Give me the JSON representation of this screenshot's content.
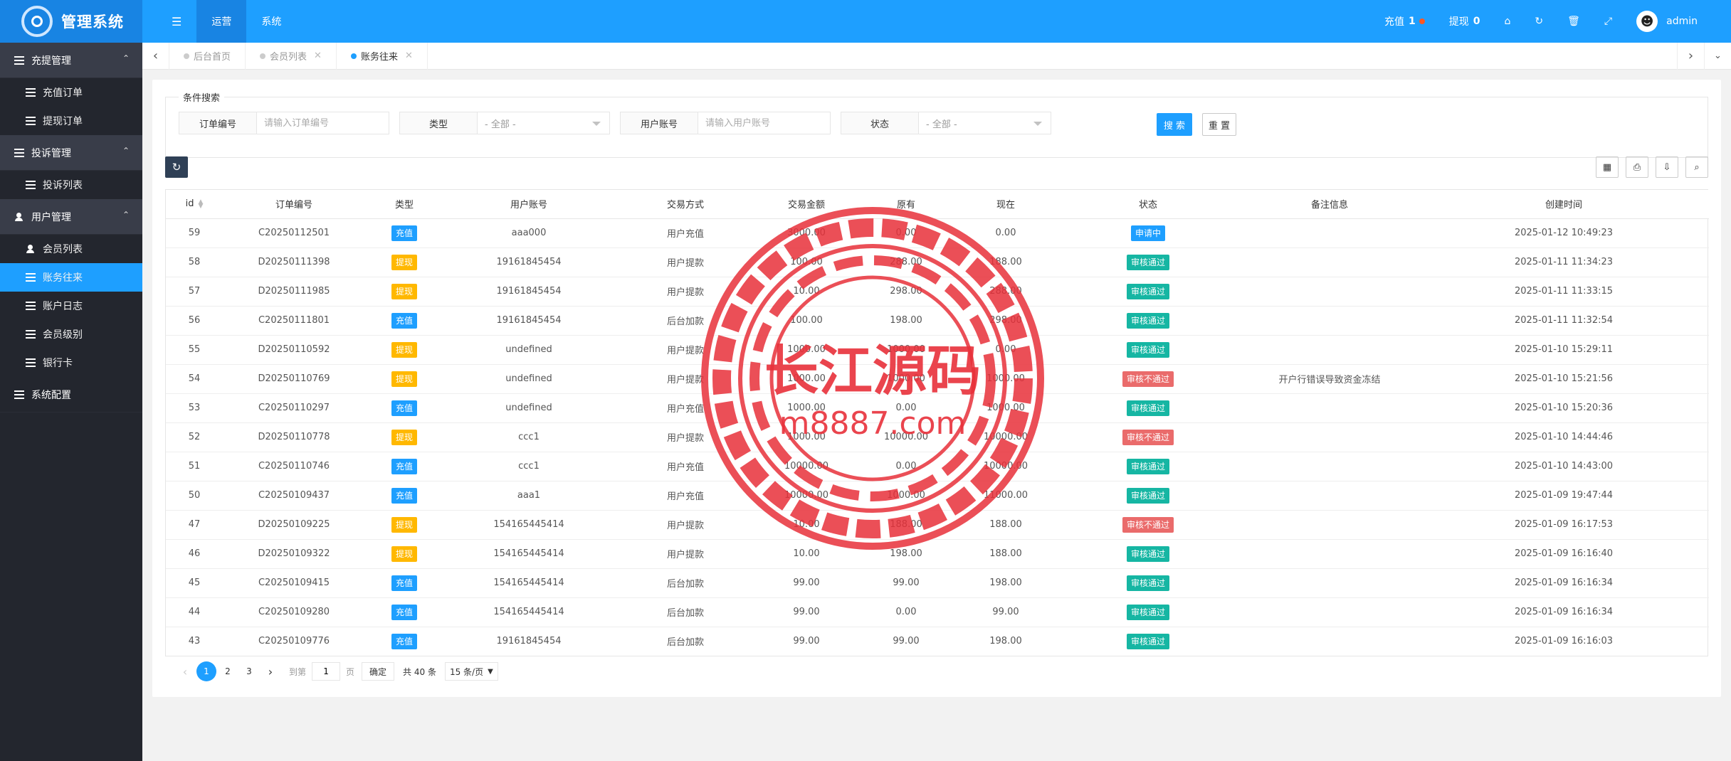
{
  "app": {
    "title": "管理系统"
  },
  "top_menu": [
    "运营",
    "系统"
  ],
  "top_right": {
    "recharge_label": "充值",
    "recharge_count": "1",
    "withdraw_label": "提现",
    "withdraw_count": "0",
    "user": "admin"
  },
  "sidebar": {
    "groups": [
      {
        "label": "充提管理",
        "items": [
          "充值订单",
          "提现订单"
        ]
      },
      {
        "label": "投诉管理",
        "items": [
          "投诉列表"
        ]
      },
      {
        "label": "用户管理",
        "items": [
          "会员列表",
          "账务往来",
          "账户日志",
          "会员级别",
          "银行卡"
        ]
      },
      {
        "label": "系统配置",
        "items": []
      }
    ],
    "active_item": "账务往来"
  },
  "tabs": [
    "后台首页",
    "会员列表",
    "账务往来"
  ],
  "search": {
    "legend": "条件搜索",
    "order_label": "订单编号",
    "order_placeholder": "请输入订单编号",
    "type_label": "类型",
    "type_value": "- 全部 -",
    "account_label": "用户账号",
    "account_placeholder": "请输入用户账号",
    "status_label": "状态",
    "status_value": "- 全部 -",
    "search_btn": "搜 索",
    "reset_btn": "重 置"
  },
  "table": {
    "columns": [
      "id",
      "订单编号",
      "类型",
      "用户账号",
      "交易方式",
      "交易金额",
      "原有",
      "现在",
      "状态",
      "备注信息",
      "创建时间"
    ],
    "rows": [
      [
        "59",
        "C20250112501",
        "充值",
        "aaa000",
        "用户充值",
        "3000.00",
        "0.00",
        "0.00",
        "申请中",
        "",
        "2025-01-12 10:49:23"
      ],
      [
        "58",
        "D20250111398",
        "提现",
        "19161845454",
        "用户提款",
        "100.00",
        "288.00",
        "188.00",
        "审核通过",
        "",
        "2025-01-11 11:34:23"
      ],
      [
        "57",
        "D20250111985",
        "提现",
        "19161845454",
        "用户提款",
        "10.00",
        "298.00",
        "288.00",
        "审核通过",
        "",
        "2025-01-11 11:33:15"
      ],
      [
        "56",
        "C20250111801",
        "充值",
        "19161845454",
        "后台加款",
        "100.00",
        "198.00",
        "298.00",
        "审核通过",
        "",
        "2025-01-11 11:32:54"
      ],
      [
        "55",
        "D20250110592",
        "提现",
        "undefined",
        "用户提款",
        "1000.00",
        "1000.00",
        "0.00",
        "审核通过",
        "",
        "2025-01-10 15:29:11"
      ],
      [
        "54",
        "D20250110769",
        "提现",
        "undefined",
        "用户提款",
        "1000.00",
        "1000.00",
        "1000.00",
        "审核不通过",
        "开户行错误导致资金冻结",
        "2025-01-10 15:21:56"
      ],
      [
        "53",
        "C20250110297",
        "充值",
        "undefined",
        "用户充值",
        "1000.00",
        "0.00",
        "1000.00",
        "审核通过",
        "",
        "2025-01-10 15:20:36"
      ],
      [
        "52",
        "D20250110778",
        "提现",
        "ccc1",
        "用户提款",
        "1000.00",
        "10000.00",
        "10000.00",
        "审核不通过",
        "",
        "2025-01-10 14:44:46"
      ],
      [
        "51",
        "C20250110746",
        "充值",
        "ccc1",
        "用户充值",
        "10000.00",
        "0.00",
        "10000.00",
        "审核通过",
        "",
        "2025-01-10 14:43:00"
      ],
      [
        "50",
        "C20250109437",
        "充值",
        "aaa1",
        "用户充值",
        "10000.00",
        "1000.00",
        "11000.00",
        "审核通过",
        "",
        "2025-01-09 19:47:44"
      ],
      [
        "47",
        "D20250109225",
        "提现",
        "154165445414",
        "用户提款",
        "10.00",
        "188.00",
        "188.00",
        "审核不通过",
        "",
        "2025-01-09 16:17:53"
      ],
      [
        "46",
        "D20250109322",
        "提现",
        "154165445414",
        "用户提款",
        "10.00",
        "198.00",
        "188.00",
        "审核通过",
        "",
        "2025-01-09 16:16:40"
      ],
      [
        "45",
        "C20250109415",
        "充值",
        "154165445414",
        "后台加款",
        "99.00",
        "99.00",
        "198.00",
        "审核通过",
        "",
        "2025-01-09 16:16:34"
      ],
      [
        "44",
        "C20250109280",
        "充值",
        "154165445414",
        "后台加款",
        "99.00",
        "0.00",
        "99.00",
        "审核通过",
        "",
        "2025-01-09 16:16:34"
      ],
      [
        "43",
        "C20250109776",
        "充值",
        "19161845454",
        "后台加款",
        "99.00",
        "99.00",
        "198.00",
        "审核通过",
        "",
        "2025-01-09 16:16:03"
      ]
    ]
  },
  "pagination": {
    "pages": [
      "1",
      "2",
      "3"
    ],
    "current": "1",
    "goto_label": "到第",
    "goto_value": "1",
    "page_unit": "页",
    "confirm": "确定",
    "total": "共 40 条",
    "limit": "15 条/页"
  },
  "watermark": {
    "text": "长江源码",
    "url": "m8887.com"
  },
  "colors": {
    "primary": "#1e9fff",
    "sidebar": "#23262e",
    "recharge": "#1e9fff",
    "withdraw": "#ffb800",
    "approved": "#16b6a3",
    "rejected": "#ea6b6b",
    "stamp": "#e8303a"
  }
}
